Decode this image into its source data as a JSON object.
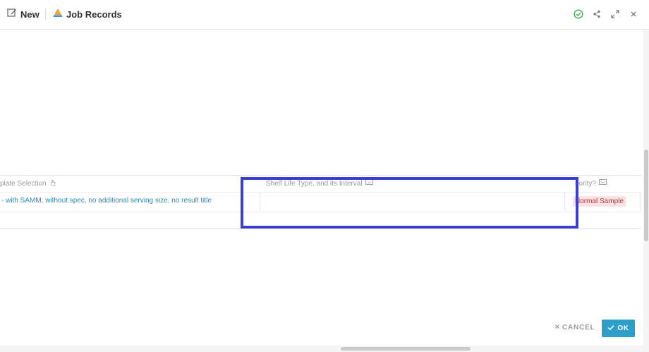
{
  "header": {
    "new_label": "New",
    "title": "Job Records",
    "icons": [
      "edit-icon",
      "app-logo-icon",
      "check-circle-icon",
      "share-icon",
      "expand-icon",
      "close-icon"
    ],
    "colors": {
      "check": "#3bb34a"
    }
  },
  "grid": {
    "columns": [
      {
        "label": "plate Selection",
        "icon": "hand-icon"
      },
      {
        "label": "Shelf Life Type, and its Interval",
        "icon": "comment-icon"
      },
      {
        "label": "riority?",
        "icon": "comment-icon"
      }
    ],
    "row": {
      "template": "- with SAMM, without spec, no additional serving size, no result title",
      "shelf_life": "",
      "priority": "Normal Sample"
    }
  },
  "footer": {
    "cancel_label": "CANCEL",
    "ok_label": "OK"
  },
  "colors": {
    "accent": "#2e9dc8",
    "link": "#2e8bb0",
    "highlight": "#3b3fd6",
    "badge_bg": "#fbe1e1",
    "badge_text": "#b23b3b"
  }
}
